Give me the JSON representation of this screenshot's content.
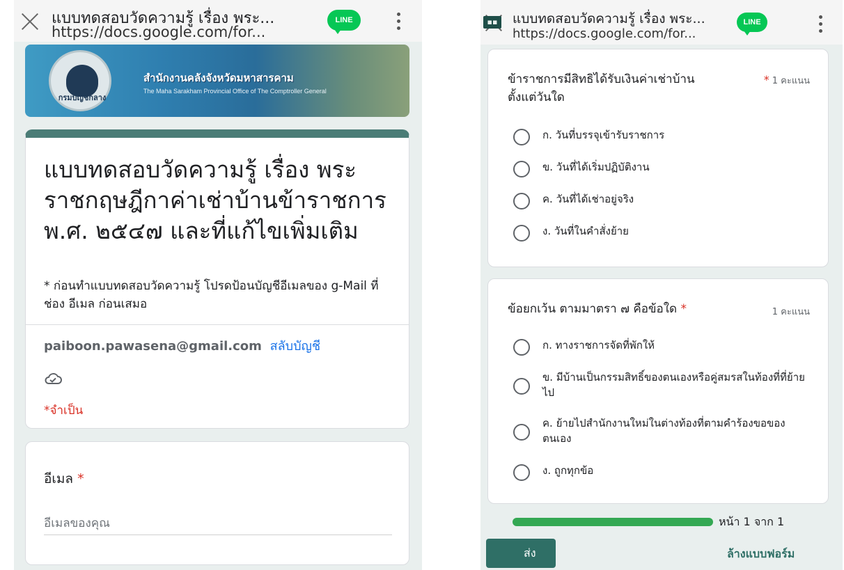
{
  "left": {
    "browser": {
      "title": "แบบทดสอบวัดความรู้ เรื่อง พระ...",
      "url": "https://docs.google.com/for...",
      "line_badge": "LINE"
    },
    "banner": {
      "org_th": "สำนักงานคลังจังหวัดมหาสารคาม",
      "org_en": "The Maha Sarakham Provincial Office of The Comptroller General",
      "emblem_text": "กรมบัญชีกลาง"
    },
    "form": {
      "title": "แบบทดสอบวัดความรู้ เรื่อง พระราชกฤษฎีกาค่าเช่าบ้านข้าราชการ พ.ศ. ๒๕๔๗ และที่แก้ไขเพิ่มเติม",
      "description": "* ก่อนทำแบบทดสอบวัดความรู้ โปรดป้อนบัญชีอีเมลของ g-Mail ที่ช่อง อีเมล ก่อนเสมอ",
      "account_email": "paiboon.pawasena@gmail.com",
      "switch_account": "สลับบัญชี",
      "required_note": "*จำเป็น",
      "accent_color": "#4a7c76"
    },
    "email_question": {
      "label": "อีเมล",
      "required_mark": "*",
      "placeholder": "อีเมลของคุณ"
    }
  },
  "right": {
    "browser": {
      "title": "แบบทดสอบวัดความรู้ เรื่อง พระ...",
      "url": "https://docs.google.com/for...",
      "line_badge": "LINE"
    },
    "questions": [
      {
        "text": "ข้าราชการมีสิทธิได้รับเงินค่าเช่าบ้านตั้งแต่วันใด",
        "required_mark": "*",
        "points": "1 คะแนน",
        "options": [
          "ก. วันที่บรรจุเข้ารับราชการ",
          "ข. วันที่ได้เริ่มปฏิบัติงาน",
          "ค. วันที่ได้เช่าอยู่จริง",
          "ง. วันที่ในคำสั่งย้าย"
        ]
      },
      {
        "text": "ข้อยกเว้น ตามมาตรา ๗ คือข้อใด",
        "required_mark": "*",
        "points": "1 คะแนน",
        "options": [
          "ก. ทางราชการจัดที่พักให้",
          "ข. มีบ้านเป็นกรรมสิทธิ์ของตนเองหรือคู่สมรสในท้องที่ที่ย้ายไป",
          "ค. ย้ายไปสำนักงานใหม่ในต่างท้องที่ตามคำร้องขอของตนเอง",
          "ง. ถูกทุกข้อ"
        ]
      }
    ],
    "progress": {
      "fraction": 1.0,
      "label": "หน้า 1 จาก 1",
      "color": "#34a853"
    },
    "submit_label": "ส่ง",
    "clear_label": "ล้างแบบฟอร์ม"
  }
}
